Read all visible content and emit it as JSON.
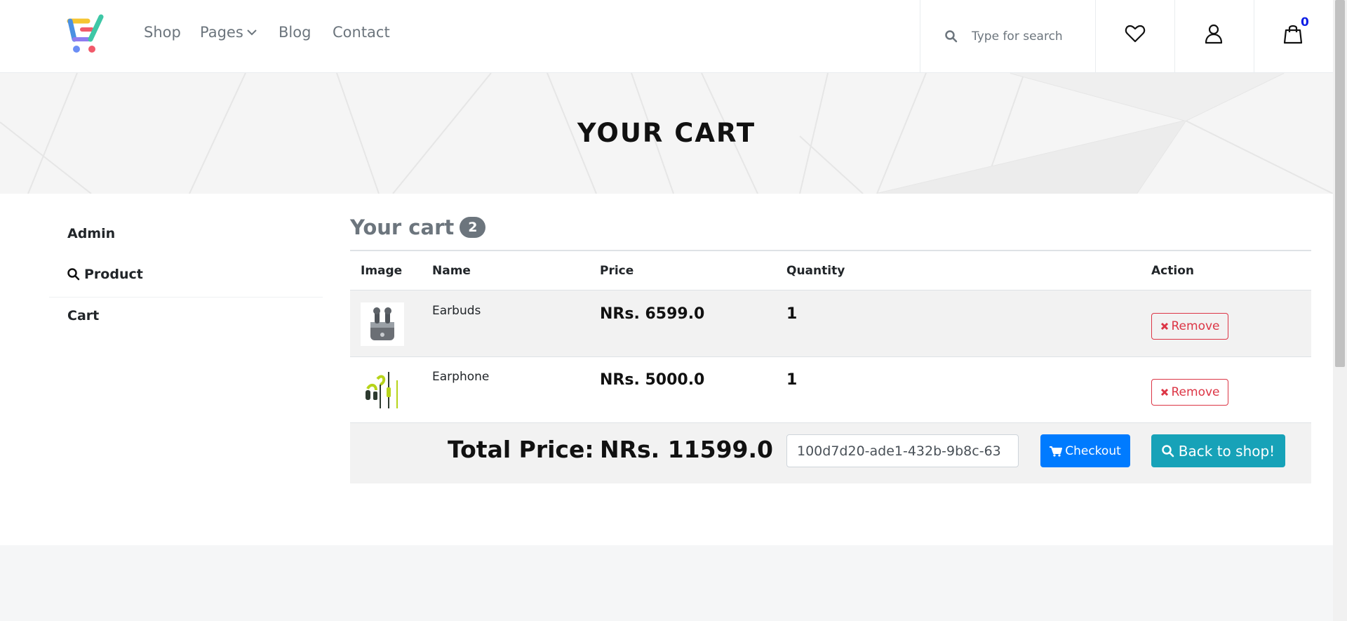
{
  "header": {
    "nav": [
      {
        "label": "Shop"
      },
      {
        "label": "Pages"
      },
      {
        "label": "Blog"
      },
      {
        "label": "Contact"
      }
    ],
    "search": {
      "placeholder": "Type for search"
    },
    "cart_count": "0"
  },
  "banner": {
    "title": "YOUR CART"
  },
  "sidebar": {
    "items": [
      {
        "label": "Admin"
      },
      {
        "label": "Product"
      },
      {
        "label": "Cart"
      }
    ]
  },
  "cart": {
    "heading": "Your cart",
    "count": "2",
    "columns": [
      "Image",
      "Name",
      "Price",
      "Quantity",
      "Action"
    ],
    "items": [
      {
        "name": "Earbuds",
        "price": "NRs. 6599.0",
        "quantity": "1",
        "action": "Remove"
      },
      {
        "name": "Earphone",
        "price": "NRs. 5000.0",
        "quantity": "1",
        "action": "Remove"
      }
    ],
    "total_label": "Total Price:",
    "total_value": "NRs. 11599.0",
    "order_id": "100d7d20-ade1-432b-9b8c-63",
    "checkout_label": "Checkout",
    "back_label": "Back to shop!"
  },
  "colors": {
    "primary": "#007bff",
    "info": "#17a2b8",
    "danger": "#dc3545",
    "secondary": "#6c757d"
  }
}
